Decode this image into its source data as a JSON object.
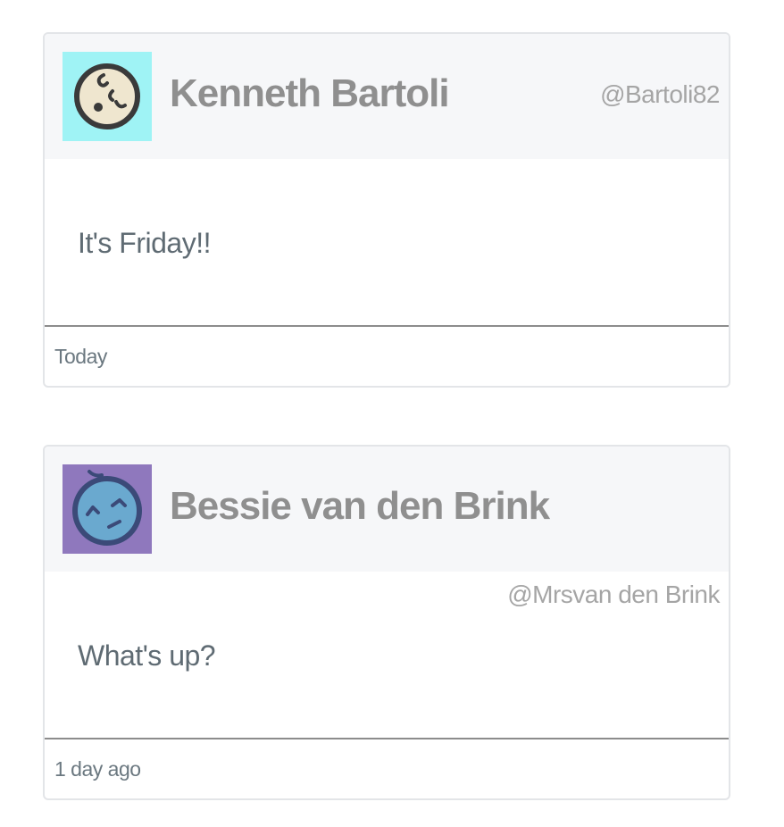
{
  "posts": [
    {
      "author_name": "Kenneth Bartoli",
      "handle": "@Bartoli82",
      "message": "It's Friday!!",
      "timestamp": "Today",
      "avatar": {
        "icon": "baby-face-avatar-icon",
        "bg_color": "#9ff3f5",
        "face_color": "#efe6cf",
        "line_color": "#3a3a3a"
      }
    },
    {
      "author_name": "Bessie van den Brink",
      "handle": "@Mrsvan den Brink",
      "message": "What's up?",
      "timestamp": "1 day ago",
      "avatar": {
        "icon": "smiling-face-avatar-icon",
        "bg_color": "#8f78bd",
        "face_color": "#6aa9cf",
        "line_color": "#3b4a78"
      }
    }
  ],
  "colors": {
    "header_bg": "#f6f7f9",
    "card_border": "#e3e5e8",
    "name_text": "#8f8f8f",
    "handle_text": "#a5a5a5",
    "message_text": "#5f6b73",
    "divider": "#8c8c8c"
  }
}
